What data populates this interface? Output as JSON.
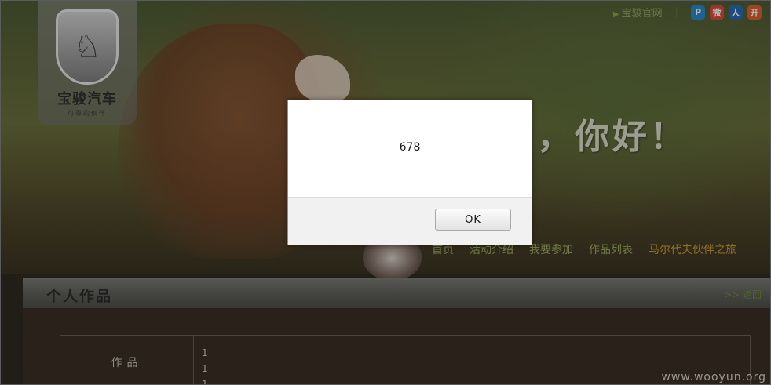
{
  "brand": {
    "logo_glyph": "♘",
    "name": "宝骏汽车",
    "slogan": "可靠的伙伴"
  },
  "top_links": {
    "official_site": "宝骏官网",
    "separator": "|",
    "social_icons": [
      {
        "icon": "qzone-icon",
        "glyph": "P",
        "color": "#2a8ac8"
      },
      {
        "icon": "weibo-icon",
        "glyph": "微",
        "color": "#d84a3a"
      },
      {
        "icon": "renren-icon",
        "glyph": "人",
        "color": "#2a6ab0"
      },
      {
        "icon": "kaixin-icon",
        "glyph": "开",
        "color": "#d8602a"
      }
    ]
  },
  "hero": {
    "greeting": "，你好！"
  },
  "nav": {
    "items": [
      "首页",
      "活动介绍",
      "我要参加",
      "作品列表",
      "马尔代夫伙伴之旅"
    ]
  },
  "section": {
    "title": "个人作品",
    "back": ">> 返回"
  },
  "works": {
    "label": "作品",
    "values": [
      "1",
      "1",
      "1"
    ]
  },
  "watermark": "www.wooyun.org",
  "dialog": {
    "message": "678",
    "ok_label": "OK"
  }
}
